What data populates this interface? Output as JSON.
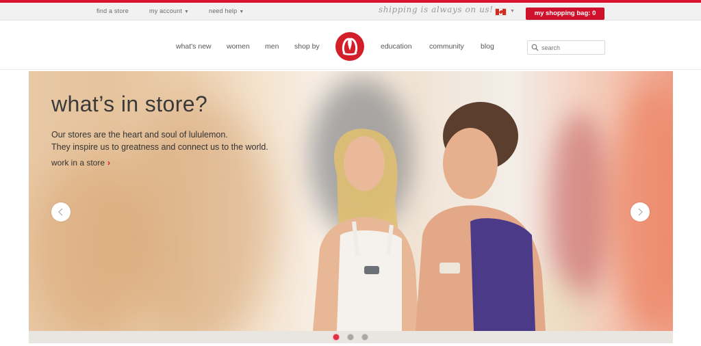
{
  "utility_bar": {
    "find_store": "find a store",
    "my_account": "my account",
    "need_help": "need help",
    "shipping_note": "shipping is always on us!",
    "country_flag": "canada-flag-icon",
    "shopping_bag": "my shopping bag: 0"
  },
  "nav": {
    "items": [
      "what's new",
      "women",
      "men",
      "shop by",
      "education",
      "community",
      "blog"
    ],
    "logo_icon": "lululemon-logo-icon",
    "search_placeholder": "search"
  },
  "hero": {
    "title": "what’s in store?",
    "subtitle_line1": "Our stores are the heart and soul of lululemon.",
    "subtitle_line2": "They inspire us to greatness and connect us to the world.",
    "cta": "work in a store",
    "prev_icon": "chevron-left-icon",
    "next_icon": "chevron-right-icon",
    "slides": 3,
    "active_slide": 1
  },
  "colors": {
    "brand_red": "#d0112b",
    "topbar_bg": "#f1f1f1"
  }
}
